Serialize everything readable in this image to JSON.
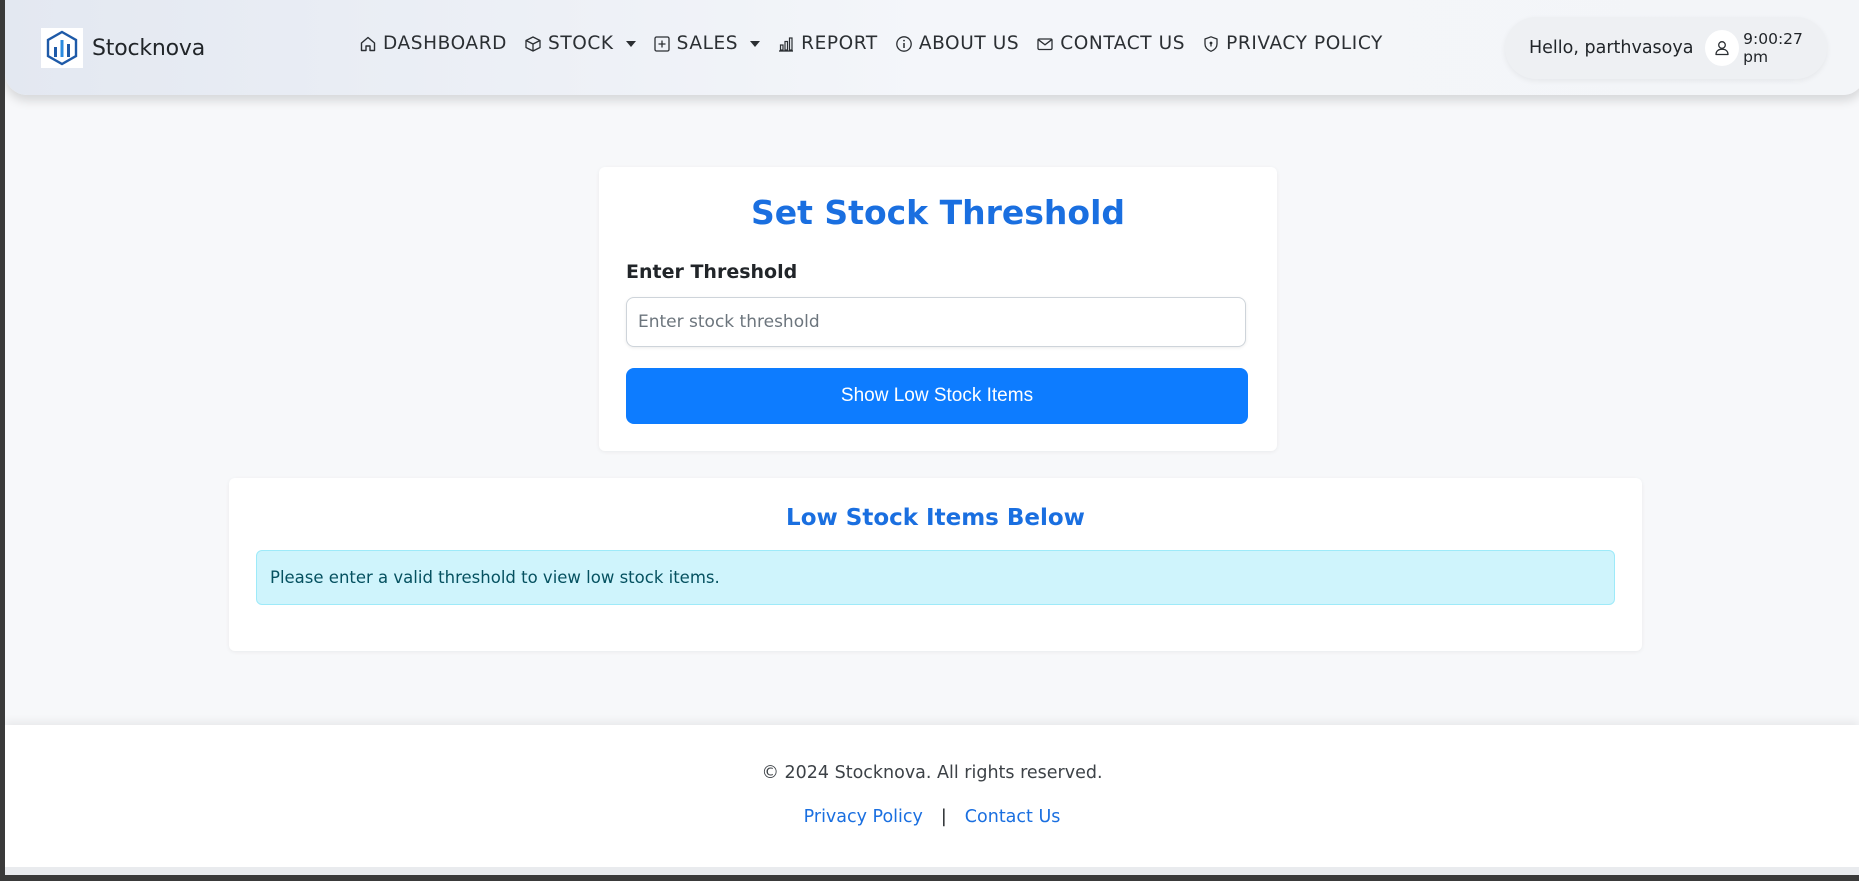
{
  "brand": {
    "name": "Stocknova",
    "logo_icon": "stocknova-logo-icon"
  },
  "nav": {
    "items": [
      {
        "label": "DASHBOARD",
        "icon": "home-icon"
      },
      {
        "label": "STOCK",
        "icon": "box-icon",
        "dropdown": true
      },
      {
        "label": "SALES",
        "icon": "plus-square-icon",
        "dropdown": true
      },
      {
        "label": "REPORT",
        "icon": "bar-chart-icon"
      },
      {
        "label": "ABOUT US",
        "icon": "info-circle-icon"
      },
      {
        "label": "CONTACT US",
        "icon": "envelope-icon"
      },
      {
        "label": "PRIVACY POLICY",
        "icon": "shield-icon"
      }
    ]
  },
  "user": {
    "greeting": "Hello, parthvasoya",
    "time": "9:00:27 pm",
    "avatar_icon": "user-icon"
  },
  "threshold_card": {
    "title": "Set Stock Threshold",
    "label": "Enter Threshold",
    "input_value": "",
    "placeholder": "Enter stock threshold",
    "button_label": "Show Low Stock Items"
  },
  "results_card": {
    "title": "Low Stock Items Below",
    "alert": "Please enter a valid threshold to view low stock items."
  },
  "footer": {
    "copyright": "© 2024 Stocknova. All rights reserved.",
    "privacy_link": "Privacy Policy",
    "separator": "|",
    "contact_link": "Contact Us"
  },
  "colors": {
    "accent": "#1a6fe0",
    "button": "#0d7cff",
    "alert_bg": "#cff4fc",
    "alert_text": "#055160"
  }
}
